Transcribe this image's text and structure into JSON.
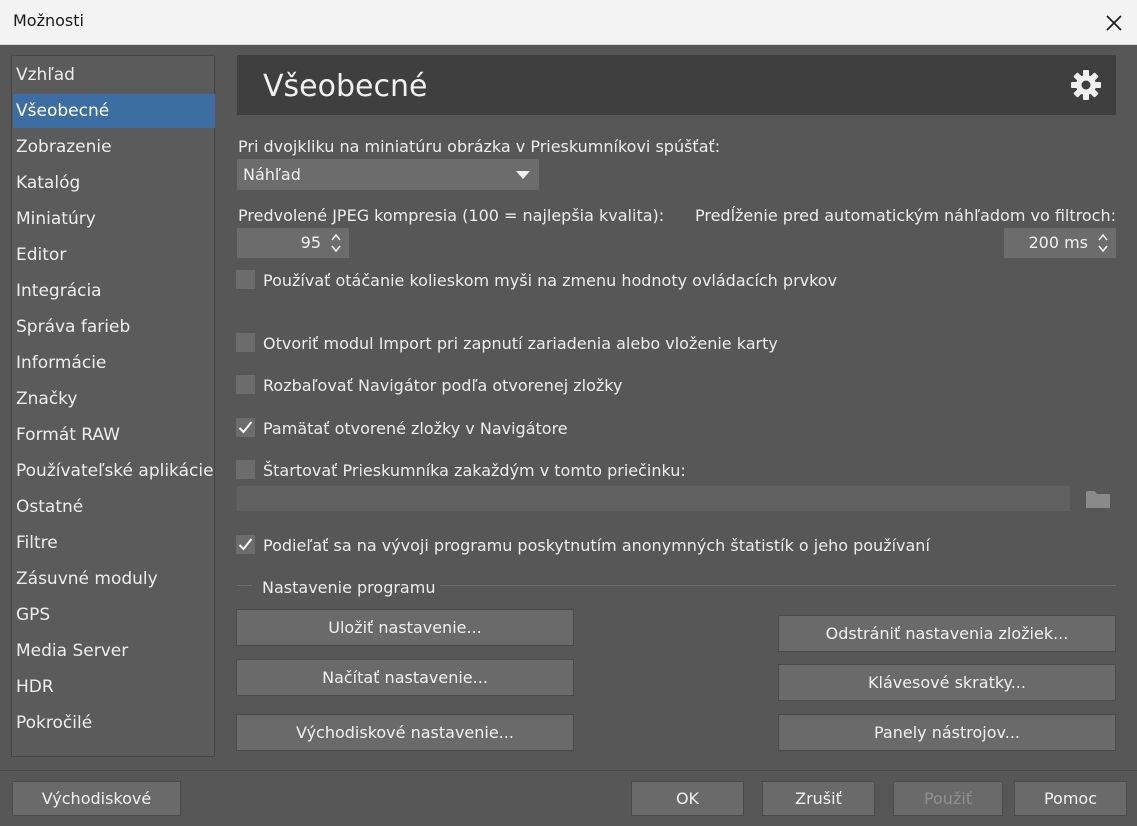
{
  "window": {
    "title": "Možnosti"
  },
  "sidebar": {
    "items": [
      {
        "label": "Vzhľad"
      },
      {
        "label": "Všeobecné"
      },
      {
        "label": "Zobrazenie"
      },
      {
        "label": "Katalóg"
      },
      {
        "label": "Miniatúry"
      },
      {
        "label": "Editor"
      },
      {
        "label": "Integrácia"
      },
      {
        "label": "Správa farieb"
      },
      {
        "label": "Informácie"
      },
      {
        "label": "Značky"
      },
      {
        "label": "Formát RAW"
      },
      {
        "label": "Používateľské aplikácie"
      },
      {
        "label": "Ostatné"
      },
      {
        "label": "Filtre"
      },
      {
        "label": "Zásuvné moduly"
      },
      {
        "label": "GPS"
      },
      {
        "label": "Media Server"
      },
      {
        "label": "HDR"
      },
      {
        "label": "Pokročilé"
      }
    ],
    "selected": "Všeobecné"
  },
  "header": {
    "title": "Všeobecné",
    "icon": "gear-icon"
  },
  "general": {
    "dblclick_label": "Pri dvojkliku na miniatúru obrázka v Prieskumníkovi spúšťať:",
    "dblclick_value": "Náhľad",
    "jpeg_label": "Predvolené JPEG kompresia (100 = najlepšia kvalita):",
    "jpeg_value": "95",
    "delay_label": "Predĺženie pred automatickým náhľadom vo filtroch:",
    "delay_value": "200 ms",
    "checkboxes": [
      {
        "label": "Používať otáčanie kolieskom myši na zmenu hodnoty ovládacích prvkov",
        "checked": false
      },
      {
        "label": "Otvoriť modul Import pri zapnutí zariadenia alebo vloženie karty",
        "checked": false
      },
      {
        "label": "Rozbaľovať Navigátor podľa otvorenej zložky",
        "checked": false
      },
      {
        "label": "Pamätať otvorené zložky v Navigátore",
        "checked": true
      },
      {
        "label": "Štartovať Prieskumníka zakaždým v tomto priečinku:",
        "checked": false
      },
      {
        "label": "Podieľať sa na vývoji programu poskytnutím anonymných štatistík o jeho používaní",
        "checked": true
      }
    ],
    "start_folder_value": ""
  },
  "program_settings": {
    "group_label": "Nastavenie programu",
    "save": "Uložiť nastavenie...",
    "load": "Načítať nastavenie...",
    "default": "Východiskové nastavenie...",
    "remove_folder_settings": "Odstrániť nastavenia zložiek...",
    "shortcuts": "Klávesové skratky...",
    "toolbars": "Panely nástrojov..."
  },
  "footer": {
    "defaults": "Východiskové",
    "ok": "OK",
    "cancel": "Zrušiť",
    "apply": "Použiť",
    "help": "Pomoc"
  },
  "colors": {
    "accent": "#3d6ea3",
    "panel": "#575757",
    "header": "#3f3f3f"
  }
}
